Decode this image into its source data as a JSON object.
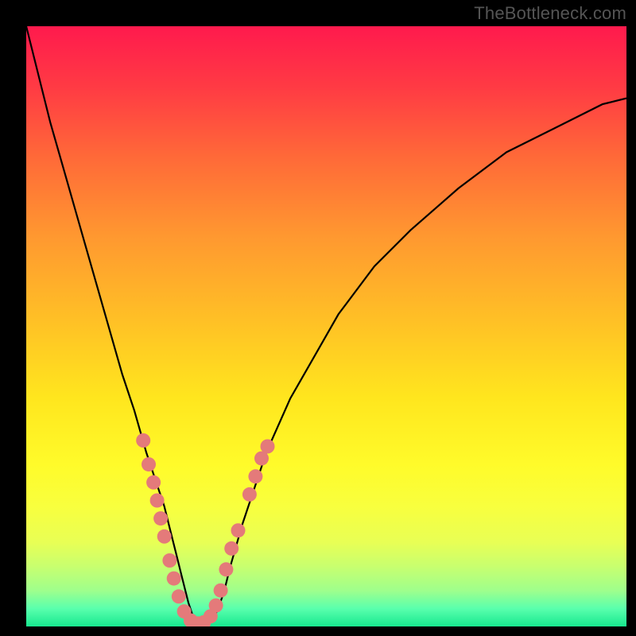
{
  "watermark": "TheBottleneck.com",
  "colors": {
    "frame": "#000000",
    "curve": "#000000",
    "dot_fill": "#e47a7a",
    "dot_stroke": "#000000"
  },
  "chart_data": {
    "type": "line",
    "title": "",
    "xlabel": "",
    "ylabel": "",
    "xlim": [
      0,
      100
    ],
    "ylim": [
      0,
      100
    ],
    "curve": {
      "series_name": "bottleneck-curve",
      "x": [
        0,
        2,
        4,
        6,
        8,
        10,
        12,
        14,
        16,
        18,
        20,
        21,
        22,
        23,
        24,
        25,
        26,
        27,
        28,
        29,
        30,
        31,
        32,
        33,
        34,
        36,
        38,
        40,
        44,
        48,
        52,
        58,
        64,
        72,
        80,
        88,
        96,
        100
      ],
      "y": [
        100,
        92,
        84,
        77,
        70,
        63,
        56,
        49,
        42,
        36,
        29,
        26,
        23,
        20,
        16,
        12,
        8,
        4,
        1,
        0,
        0,
        1,
        3,
        6,
        10,
        17,
        23,
        29,
        38,
        45,
        52,
        60,
        66,
        73,
        79,
        83,
        87,
        88
      ]
    },
    "dots": {
      "series_name": "dot-cluster",
      "points": [
        {
          "x": 19.5,
          "y": 31
        },
        {
          "x": 20.4,
          "y": 27
        },
        {
          "x": 21.2,
          "y": 24
        },
        {
          "x": 21.8,
          "y": 21
        },
        {
          "x": 22.4,
          "y": 18
        },
        {
          "x": 23.0,
          "y": 15
        },
        {
          "x": 23.9,
          "y": 11
        },
        {
          "x": 24.6,
          "y": 8
        },
        {
          "x": 25.4,
          "y": 5
        },
        {
          "x": 26.3,
          "y": 2.5
        },
        {
          "x": 27.4,
          "y": 1
        },
        {
          "x": 28.6,
          "y": 0.5
        },
        {
          "x": 29.6,
          "y": 0.7
        },
        {
          "x": 30.7,
          "y": 1.7
        },
        {
          "x": 31.6,
          "y": 3.5
        },
        {
          "x": 32.4,
          "y": 6
        },
        {
          "x": 33.3,
          "y": 9.5
        },
        {
          "x": 34.2,
          "y": 13
        },
        {
          "x": 35.3,
          "y": 16
        },
        {
          "x": 37.2,
          "y": 22
        },
        {
          "x": 38.2,
          "y": 25
        },
        {
          "x": 39.2,
          "y": 28
        },
        {
          "x": 40.2,
          "y": 30
        }
      ]
    }
  }
}
